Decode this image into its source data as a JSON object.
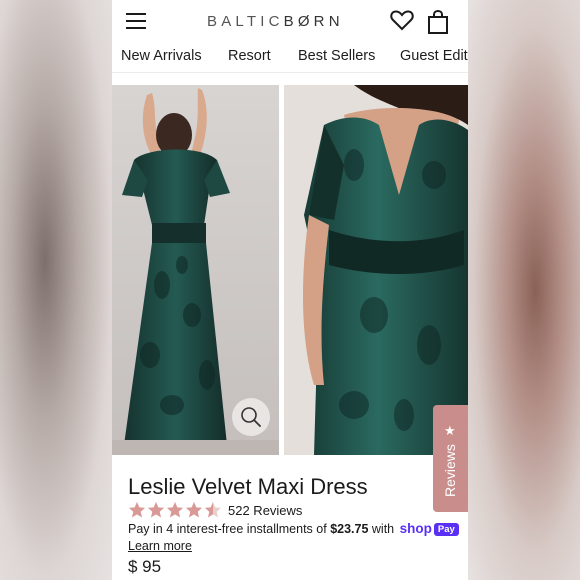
{
  "header": {
    "brand_prefix": "BALTIC",
    "brand_suffix": "BØRN"
  },
  "nav": {
    "items": [
      "New Arrivals",
      "Resort",
      "Best Sellers",
      "Guest Edit"
    ]
  },
  "reviews_tab": {
    "label": "Reviews"
  },
  "product": {
    "title": "Leslie Velvet Maxi Dress",
    "rating": 4.5,
    "rating_max": 5,
    "review_count": "522 Reviews",
    "installments_prefix": "Pay in 4 interest-free installments of ",
    "installment_amount": "$23.75",
    "installments_suffix": " with ",
    "shop_logo": "shop",
    "shop_pay_badge": "Pay",
    "learn_more": "Learn more",
    "price": "$ 95"
  },
  "colors": {
    "star": "#d99a97",
    "reviews_tab": "#c98d8b",
    "shop_pay": "#5a31f4",
    "dress": "#1d4a44"
  },
  "icons": [
    "hamburger-menu-icon",
    "heart-icon",
    "shopping-bag-icon",
    "magnifier-icon",
    "star-icon"
  ]
}
